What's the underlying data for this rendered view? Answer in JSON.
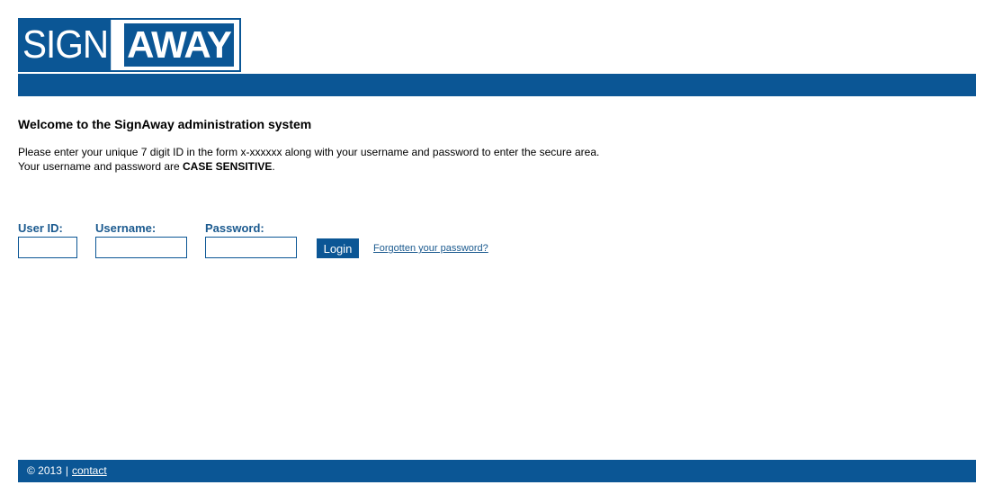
{
  "logo": {
    "left_text": "SIGN",
    "right_text": "AWAY"
  },
  "colors": {
    "brand": "#0b5695",
    "label": "#1b5a8f"
  },
  "main": {
    "welcome": "Welcome to the SignAway administration system",
    "instructions_line1": "Please enter your unique 7 digit ID in the form x-xxxxxx along with your username and password to enter the secure area.",
    "instructions_line2_prefix": "Your username and password are ",
    "instructions_line2_strong": "CASE SENSITIVE",
    "instructions_line2_suffix": "."
  },
  "form": {
    "user_id_label": "User ID:",
    "user_id_value": "",
    "username_label": "Username:",
    "username_value": "",
    "password_label": "Password:",
    "password_value": "",
    "login_label": "Login",
    "forgot_label": "Forgotten your password?"
  },
  "footer": {
    "copyright": "© 2013",
    "separator": "|",
    "contact_label": "contact"
  }
}
